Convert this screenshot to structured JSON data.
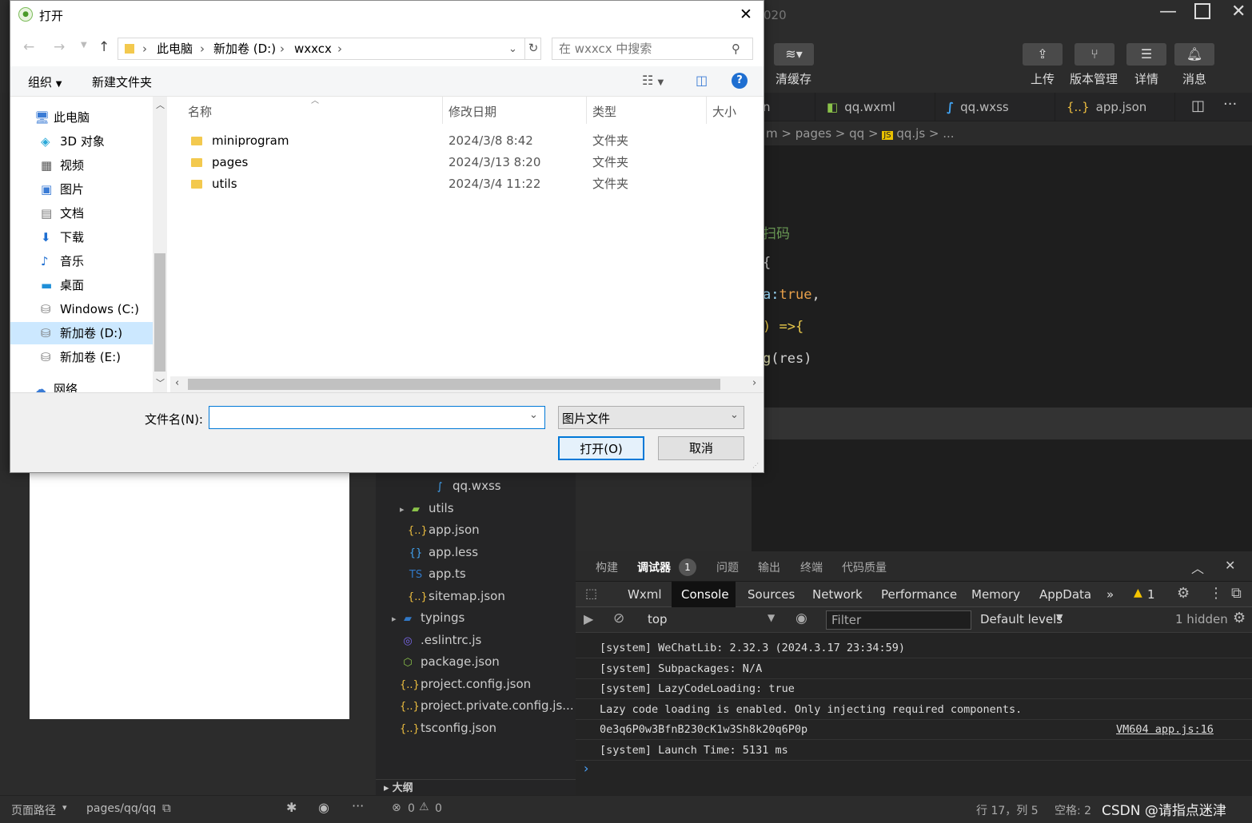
{
  "ide": {
    "title_fragment": "020",
    "toolbar": {
      "clear_cache_label": "清缓存",
      "upload_label": "上传",
      "version_label": "版本管理",
      "details_label": "详情",
      "messages_label": "消息"
    },
    "tabs": [
      {
        "label": "n",
        "icon": "json-icon"
      },
      {
        "label": "qq.wxml",
        "icon": "wxml-icon"
      },
      {
        "label": "qq.wxss",
        "icon": "css-icon"
      },
      {
        "label": "app.json",
        "icon": "json-icon"
      }
    ],
    "breadcrumb": {
      "p1": "m",
      "p2": "pages",
      "p3": "qq",
      "p4": "qq.js",
      "p5": "..."
    },
    "code_lines": {
      "l1": "扫码",
      "l2": "{",
      "l3a": "a:",
      "l3b": "true",
      "l3c": ",",
      "l4": ") =>{",
      "l5a": "g",
      "l5b": "(res)"
    },
    "file_tree": [
      {
        "label": "qq.wxss",
        "icon": "css-icon",
        "indent": 3
      },
      {
        "label": "utils",
        "icon": "folder-icon",
        "indent": 1,
        "arrow": true
      },
      {
        "label": "app.json",
        "icon": "json-icon",
        "indent": 1
      },
      {
        "label": "app.less",
        "icon": "less-icon",
        "indent": 1
      },
      {
        "label": "app.ts",
        "icon": "ts-icon",
        "indent": 1
      },
      {
        "label": "sitemap.json",
        "icon": "json-icon",
        "indent": 1
      },
      {
        "label": "typings",
        "icon": "ts-folder-icon",
        "indent": 0,
        "arrow": true
      },
      {
        "label": ".eslintrc.js",
        "icon": "eslint-icon",
        "indent": 0
      },
      {
        "label": "package.json",
        "icon": "node-icon",
        "indent": 0
      },
      {
        "label": "project.config.json",
        "icon": "json-icon",
        "indent": 0
      },
      {
        "label": "project.private.config.js...",
        "icon": "json-icon",
        "indent": 0
      },
      {
        "label": "tsconfig.json",
        "icon": "json-icon",
        "indent": 0
      }
    ],
    "outline_label": "大纲",
    "status_left": {
      "page_path_label": "页面路径",
      "page_path_value": "pages/qq/qq"
    },
    "status_mid": {
      "errors": "0",
      "warnings": "0",
      "position": "行 17，列 5",
      "spaces": "空格: 2",
      "watermark": "CSDN @请指点迷津"
    },
    "debug": {
      "top_tabs": [
        "构建",
        "调试器",
        "问题",
        "输出",
        "终端",
        "代码质量"
      ],
      "debugger_badge": "1",
      "dev_tabs": [
        "Wxml",
        "Console",
        "Sources",
        "Network",
        "Performance",
        "Memory",
        "AppData"
      ],
      "active_dev_tab": "Console",
      "more_label": "»",
      "warning_count": "1",
      "context": "top",
      "filter_placeholder": "Filter",
      "levels": "Default levels",
      "hidden": "1 hidden",
      "logs": [
        {
          "text": "[system] WeChatLib: 2.32.3 (2024.3.17 23:34:59)",
          "source": ""
        },
        {
          "text": "[system] Subpackages: N/A",
          "source": ""
        },
        {
          "text": "[system] LazyCodeLoading: true",
          "source": ""
        },
        {
          "text": "Lazy code loading is enabled. Only injecting required components.",
          "source": ""
        },
        {
          "text": "0e3q6P0w3BfnB230cK1w3Sh8k20q6P0p",
          "source": "VM604 app.js:16"
        },
        {
          "text": "[system] Launch Time: 5131 ms",
          "source": ""
        }
      ],
      "prompt": "›"
    }
  },
  "dialog": {
    "title": "打开",
    "address": {
      "seg1": "此电脑",
      "seg2": "新加卷 (D:)",
      "seg3": "wxxcx"
    },
    "search_placeholder": "在 wxxcx 中搜索",
    "toolbar": {
      "organize": "组织",
      "new_folder": "新建文件夹"
    },
    "nav_items": [
      {
        "label": "此电脑",
        "icon": "pc-icon",
        "indent": 0,
        "selected": false
      },
      {
        "label": "3D 对象",
        "icon": "3d-objects-icon",
        "indent": 1,
        "selected": false
      },
      {
        "label": "视频",
        "icon": "video-icon",
        "indent": 1,
        "selected": false
      },
      {
        "label": "图片",
        "icon": "pictures-icon",
        "indent": 1,
        "selected": false
      },
      {
        "label": "文档",
        "icon": "documents-icon",
        "indent": 1,
        "selected": false
      },
      {
        "label": "下载",
        "icon": "download-icon",
        "indent": 1,
        "selected": false
      },
      {
        "label": "音乐",
        "icon": "music-icon",
        "indent": 1,
        "selected": false
      },
      {
        "label": "桌面",
        "icon": "desktop-icon",
        "indent": 1,
        "selected": false
      },
      {
        "label": "Windows (C:)",
        "icon": "drive-icon",
        "indent": 1,
        "selected": false
      },
      {
        "label": "新加卷 (D:)",
        "icon": "drive-icon",
        "indent": 1,
        "selected": true
      },
      {
        "label": "新加卷 (E:)",
        "icon": "drive-icon",
        "indent": 1,
        "selected": false
      },
      {
        "label": "网络",
        "icon": "network-icon",
        "indent": 0,
        "selected": false
      }
    ],
    "columns": {
      "name": "名称",
      "modified": "修改日期",
      "type": "类型",
      "size": "大小"
    },
    "files": [
      {
        "name": "miniprogram",
        "modified": "2024/3/8 8:42",
        "type": "文件夹"
      },
      {
        "name": "pages",
        "modified": "2024/3/13 8:20",
        "type": "文件夹"
      },
      {
        "name": "utils",
        "modified": "2024/3/4 11:22",
        "type": "文件夹"
      }
    ],
    "filename_label": "文件名(N):",
    "filename_value": "",
    "filetype_value": "图片文件",
    "open_button": "打开(O)",
    "cancel_button": "取消"
  }
}
